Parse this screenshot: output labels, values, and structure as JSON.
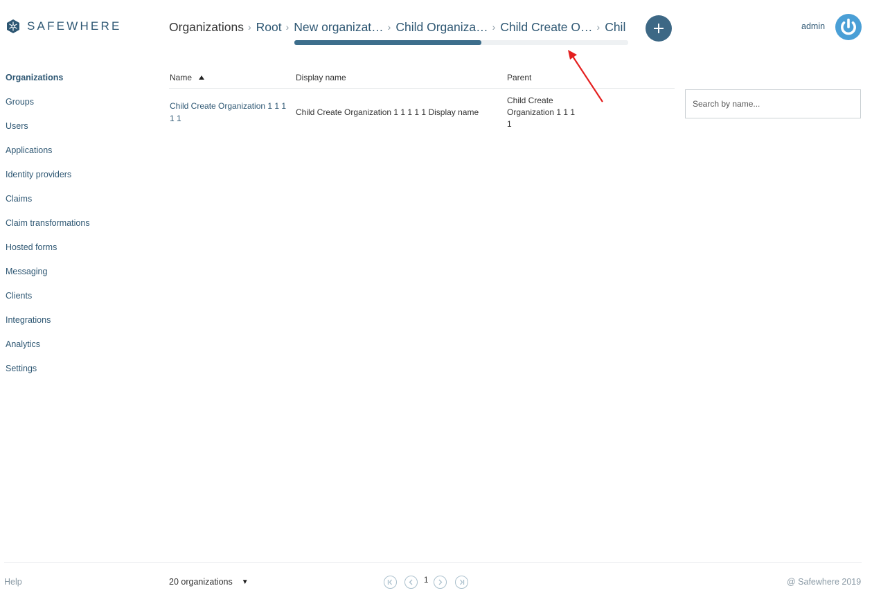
{
  "brand": {
    "name": "SAFEWHERE"
  },
  "breadcrumb": [
    {
      "label": "Organizations"
    },
    {
      "label": "Root"
    },
    {
      "label": "New organizat…"
    },
    {
      "label": "Child Organiza…"
    },
    {
      "label": "Child Create O…"
    },
    {
      "label": "Chil"
    }
  ],
  "breadcrumb_scroll": {
    "visible_fraction": 0.56
  },
  "user": {
    "name": "admin"
  },
  "sidebar": {
    "items": [
      {
        "label": "Organizations",
        "active": true
      },
      {
        "label": "Groups"
      },
      {
        "label": "Users"
      },
      {
        "label": "Applications"
      },
      {
        "label": "Identity providers"
      },
      {
        "label": "Claims"
      },
      {
        "label": "Claim transformations"
      },
      {
        "label": "Hosted forms"
      },
      {
        "label": "Messaging"
      },
      {
        "label": "Clients"
      },
      {
        "label": "Integrations"
      },
      {
        "label": "Analytics"
      },
      {
        "label": "Settings"
      }
    ]
  },
  "table": {
    "columns": {
      "name": "Name",
      "display_name": "Display name",
      "parent": "Parent"
    },
    "sort": {
      "column": "name",
      "direction": "ascending"
    },
    "rows": [
      {
        "name": "Child Create Organization 1 1 1 1 1",
        "display_name": "Child Create Organization 1 1 1 1 1 Display name",
        "parent": "Child Create Organization 1 1 1 1"
      }
    ]
  },
  "search": {
    "placeholder": "Search by name..."
  },
  "footer": {
    "help": "Help",
    "count_label": "20 organizations",
    "page": "1",
    "copyright": "@ Safewhere 2019"
  },
  "colors": {
    "brand": "#2e5773",
    "accent_button": "#3d6885",
    "power_icon": "#4a9fd6",
    "annotation_arrow": "#e41f1f"
  },
  "icons": {
    "logo": "snowflake-hexagon-icon",
    "add": "plus-icon",
    "power": "power-icon",
    "pager": [
      "first-page-icon",
      "prev-page-icon",
      "next-page-icon",
      "last-page-icon"
    ]
  }
}
